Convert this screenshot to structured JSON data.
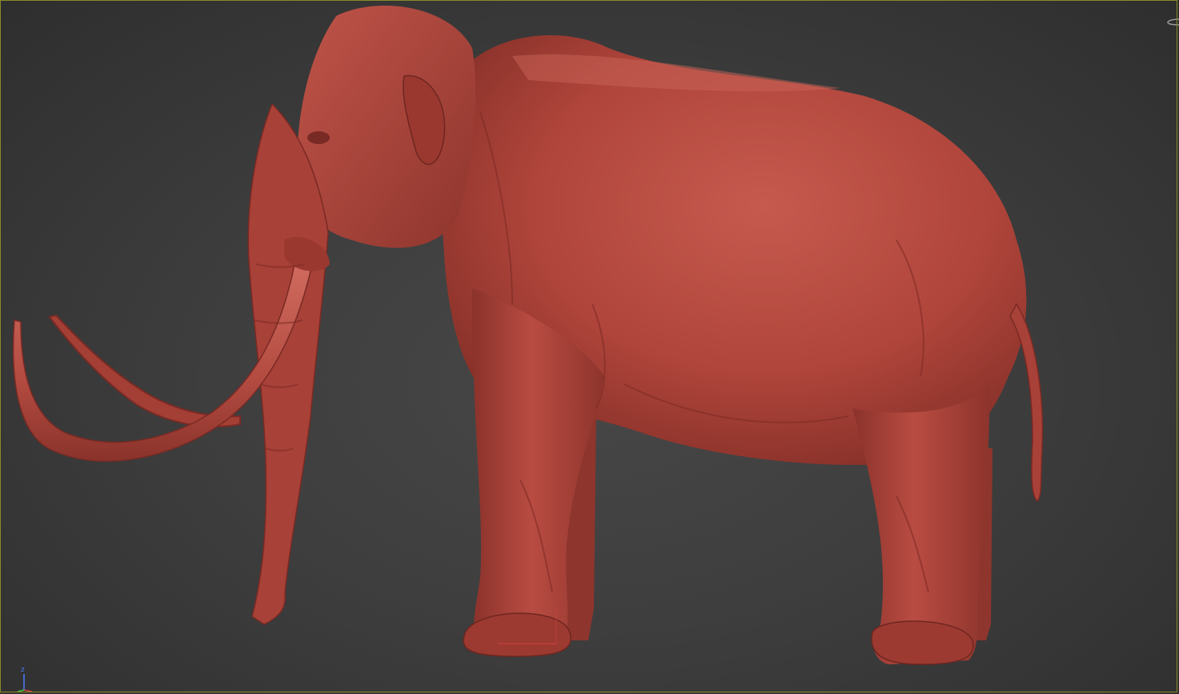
{
  "viewport": {
    "background_color": "#3e3e3e",
    "border_color": "#8a8a2a",
    "model": {
      "subject": "mammoth-sculpt",
      "material_color": "#b5493f",
      "shadow_color": "#7a2a24",
      "highlight_color": "#cf6a5e"
    },
    "axis_gizmo": {
      "z_label": "z",
      "z_color": "#4a7cff",
      "x_color": "#d04040",
      "y_color": "#40c040"
    }
  }
}
